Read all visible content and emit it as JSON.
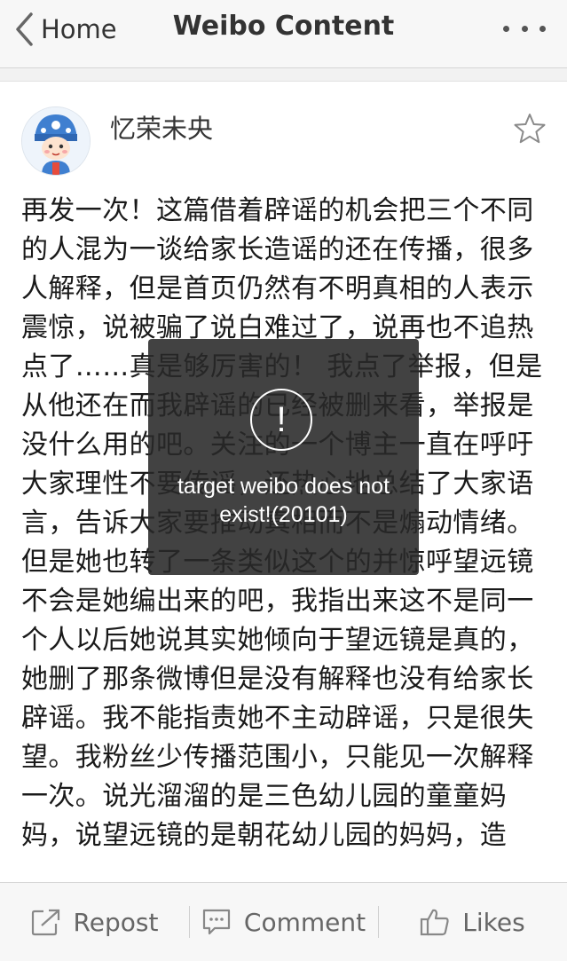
{
  "nav": {
    "back_label": "Home",
    "title": "Weibo Content"
  },
  "post": {
    "username": "忆荣未央",
    "text": "再发一次！这篇借着辟谣的机会把三个不同的人混为一谈给家长造谣的还在传播，很多人解释，但是首页仍然有不明真相的人表示震惊，说被骗了说白难过了，说再也不追热点了……真是够厉害的！ 我点了举报，但是从他还在而我辟谣的已经被删来看，举报是没什么用的吧。关注的一个博主一直在呼吁大家理性不要传谣，还热心地总结了大家语言，告诉大家要推动真相而不是煽动情绪。但是她也转了一条类似这个的并惊呼望远镜不会是她编出来的吧，我指出来这不是同一个人以后她说其实她倾向于望远镜是真的，她删了那条微博但是没有解释也没有给家长辟谣。我不能指责她不主动辟谣，只是很失望。我粉丝少传播范围小，只能见一次解释一次。说光溜溜的是三色幼儿园的童童妈妈，说望远镜的是朝花幼儿园的妈妈，造"
  },
  "toast": {
    "icon_glyph": "!",
    "message": "target weibo does not exist!(20101)"
  },
  "toolbar": {
    "repost_label": "Repost",
    "comment_label": "Comment",
    "likes_label": "Likes"
  },
  "icons": {
    "back": "chevron-left-icon",
    "more": "more-dots-icon",
    "favorite": "star-outline-icon",
    "repost": "share-out-icon",
    "comment": "comment-bubble-icon",
    "likes": "thumbs-up-icon",
    "toast": "exclamation-circle-icon"
  },
  "colors": {
    "nav_bg": "#f7f7f7",
    "text": "#1a1a1a",
    "toast_bg": "#282828",
    "toolbar_text": "#666666"
  }
}
